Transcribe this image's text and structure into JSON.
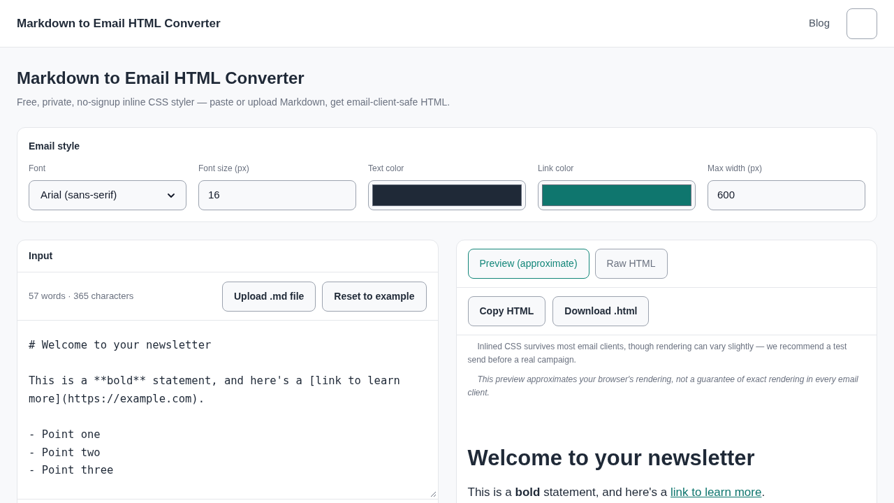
{
  "header": {
    "title": "Markdown to Email HTML Converter",
    "nav_link": "Blog"
  },
  "page": {
    "title": "Markdown to Email HTML Converter",
    "subtitle": "Free, private, no-signup inline CSS styler — paste or upload Markdown, get email-client-safe HTML."
  },
  "email_style": {
    "title": "Email style",
    "fields": [
      {
        "kind": "select",
        "label": "Font",
        "value": "Arial (sans-serif)"
      },
      {
        "kind": "number",
        "label": "Font size (px)",
        "value": "16"
      },
      {
        "kind": "color",
        "label": "Text color",
        "color": "#1f2937"
      },
      {
        "kind": "color",
        "label": "Link color",
        "color": "#0f766e"
      },
      {
        "kind": "number",
        "label": "Max width (px)",
        "value": "600"
      }
    ]
  },
  "input_panel": {
    "title": "Input",
    "stats": "57 words · 365 characters",
    "buttons": [
      "Upload .md file",
      "Reset to example"
    ],
    "markdown": "# Welcome to your newsletter\n\nThis is a **bold** statement, and here's a [link to learn more](https://example.com).\n\n- Point one\n- Point two\n- Point three"
  },
  "output_panel": {
    "tabs": [
      {
        "label": "Preview (approximate)",
        "selected": true
      },
      {
        "label": "Raw HTML",
        "selected": false
      }
    ],
    "buttons": [
      "Copy HTML",
      "Download .html"
    ],
    "notes": [
      {
        "kind": "plain",
        "text": "Inlined CSS survives most email clients, though rendering can vary slightly — we recommend a test send before a real campaign."
      },
      {
        "kind": "italic",
        "text": "This preview approximates your browser's rendering, not a guarantee of exact rendering in every email client."
      }
    ],
    "preview": {
      "heading": "Welcome to your newsletter",
      "paragraph": {
        "before": "This is a **bold** statement, and here's a ",
        "link": "link to learn more",
        "after": "."
      }
    }
  }
}
